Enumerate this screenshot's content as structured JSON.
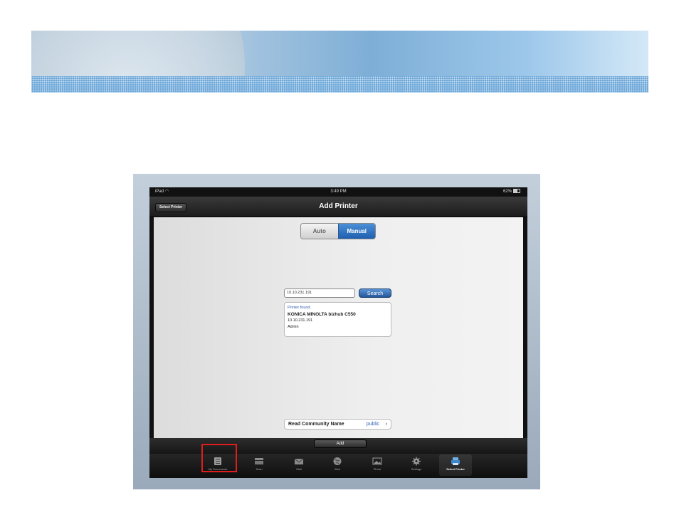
{
  "statusbar": {
    "device": "iPad",
    "time": "3:49 PM",
    "battery": "62%"
  },
  "navbar": {
    "back_label": "Select Printer",
    "title": "Add Printer"
  },
  "mode_toggle": {
    "auto_label": "Auto",
    "manual_label": "Manual",
    "selected": "Manual"
  },
  "search": {
    "ip_value": "10.10.231.191",
    "button_label": "Search"
  },
  "result": {
    "status": "Printer found.",
    "model": "KONICA MINOLTA bizhub C550",
    "ip": "10.10.231.191",
    "user": "Admin"
  },
  "community": {
    "label": "Read Community Name",
    "value": "public"
  },
  "add_button": "Add",
  "tabs": [
    {
      "label": "My Documents",
      "icon": "documents-icon"
    },
    {
      "label": "Scan",
      "icon": "scanner-icon"
    },
    {
      "label": "Mail",
      "icon": "mail-icon"
    },
    {
      "label": "Web",
      "icon": "globe-icon"
    },
    {
      "label": "Photo",
      "icon": "photo-icon"
    },
    {
      "label": "Settings",
      "icon": "gear-icon"
    },
    {
      "label": "Select Printer",
      "icon": "printer-icon"
    }
  ],
  "active_tab": "Select Printer",
  "highlighted_tab": "My Documents",
  "colors": {
    "accent_blue": "#2a64b4",
    "highlight_red": "#e01d1d"
  }
}
